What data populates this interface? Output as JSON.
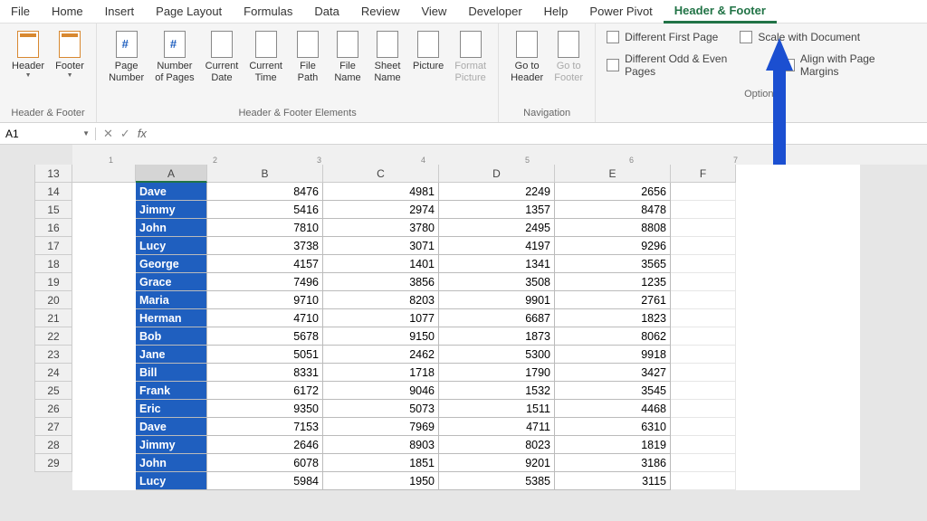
{
  "tabs": [
    "File",
    "Home",
    "Insert",
    "Page Layout",
    "Formulas",
    "Data",
    "Review",
    "View",
    "Developer",
    "Help",
    "Power Pivot",
    "Header & Footer"
  ],
  "active_tab": 11,
  "ribbon": {
    "groups": [
      {
        "label": "Header & Footer",
        "buttons": [
          {
            "label": "Header",
            "drop": true
          },
          {
            "label": "Footer",
            "drop": true
          }
        ]
      },
      {
        "label": "Header & Footer Elements",
        "buttons": [
          {
            "label": "Page\nNumber"
          },
          {
            "label": "Number\nof Pages"
          },
          {
            "label": "Current\nDate"
          },
          {
            "label": "Current\nTime"
          },
          {
            "label": "File\nPath"
          },
          {
            "label": "File\nName"
          },
          {
            "label": "Sheet\nName"
          },
          {
            "label": "Picture"
          },
          {
            "label": "Format\nPicture",
            "disabled": true
          }
        ]
      },
      {
        "label": "Navigation",
        "buttons": [
          {
            "label": "Go to\nHeader"
          },
          {
            "label": "Go to\nFooter",
            "disabled": true
          }
        ]
      }
    ],
    "options_label": "Options",
    "checks": [
      {
        "label": "Different First Page",
        "row": 0
      },
      {
        "label": "Scale with Document",
        "row": 0
      },
      {
        "label": "Different Odd & Even Pages",
        "row": 1
      },
      {
        "label": "Align with Page Margins",
        "row": 1
      }
    ]
  },
  "namebox": {
    "cell": "A1",
    "fx": "fx"
  },
  "cols": [
    "A",
    "B",
    "C",
    "D",
    "E",
    "F"
  ],
  "ruler": [
    "1",
    "2",
    "3",
    "4",
    "5",
    "6",
    "7"
  ],
  "row_start": 13,
  "rows": [
    {
      "name": "Dave",
      "b": 8476,
      "c": 4981,
      "d": 2249,
      "e": 2656
    },
    {
      "name": "Jimmy",
      "b": 5416,
      "c": 2974,
      "d": 1357,
      "e": 8478
    },
    {
      "name": "John",
      "b": 7810,
      "c": 3780,
      "d": 2495,
      "e": 8808
    },
    {
      "name": "Lucy",
      "b": 3738,
      "c": 3071,
      "d": 4197,
      "e": 9296
    },
    {
      "name": "George",
      "b": 4157,
      "c": 1401,
      "d": 1341,
      "e": 3565
    },
    {
      "name": "Grace",
      "b": 7496,
      "c": 3856,
      "d": 3508,
      "e": 1235
    },
    {
      "name": "Maria",
      "b": 9710,
      "c": 8203,
      "d": 9901,
      "e": 2761
    },
    {
      "name": "Herman",
      "b": 4710,
      "c": 1077,
      "d": 6687,
      "e": 1823
    },
    {
      "name": "Bob",
      "b": 5678,
      "c": 9150,
      "d": 1873,
      "e": 8062
    },
    {
      "name": "Jane",
      "b": 5051,
      "c": 2462,
      "d": 5300,
      "e": 9918
    },
    {
      "name": "Bill",
      "b": 8331,
      "c": 1718,
      "d": 1790,
      "e": 3427
    },
    {
      "name": "Frank",
      "b": 6172,
      "c": 9046,
      "d": 1532,
      "e": 3545
    },
    {
      "name": "Eric",
      "b": 9350,
      "c": 5073,
      "d": 1511,
      "e": 4468
    },
    {
      "name": "Dave",
      "b": 7153,
      "c": 7969,
      "d": 4711,
      "e": 6310
    },
    {
      "name": "Jimmy",
      "b": 2646,
      "c": 8903,
      "d": 8023,
      "e": 1819
    },
    {
      "name": "John",
      "b": 6078,
      "c": 1851,
      "d": 9201,
      "e": 3186
    },
    {
      "name": "Lucy",
      "b": 5984,
      "c": 1950,
      "d": 5385,
      "e": 3115
    }
  ]
}
